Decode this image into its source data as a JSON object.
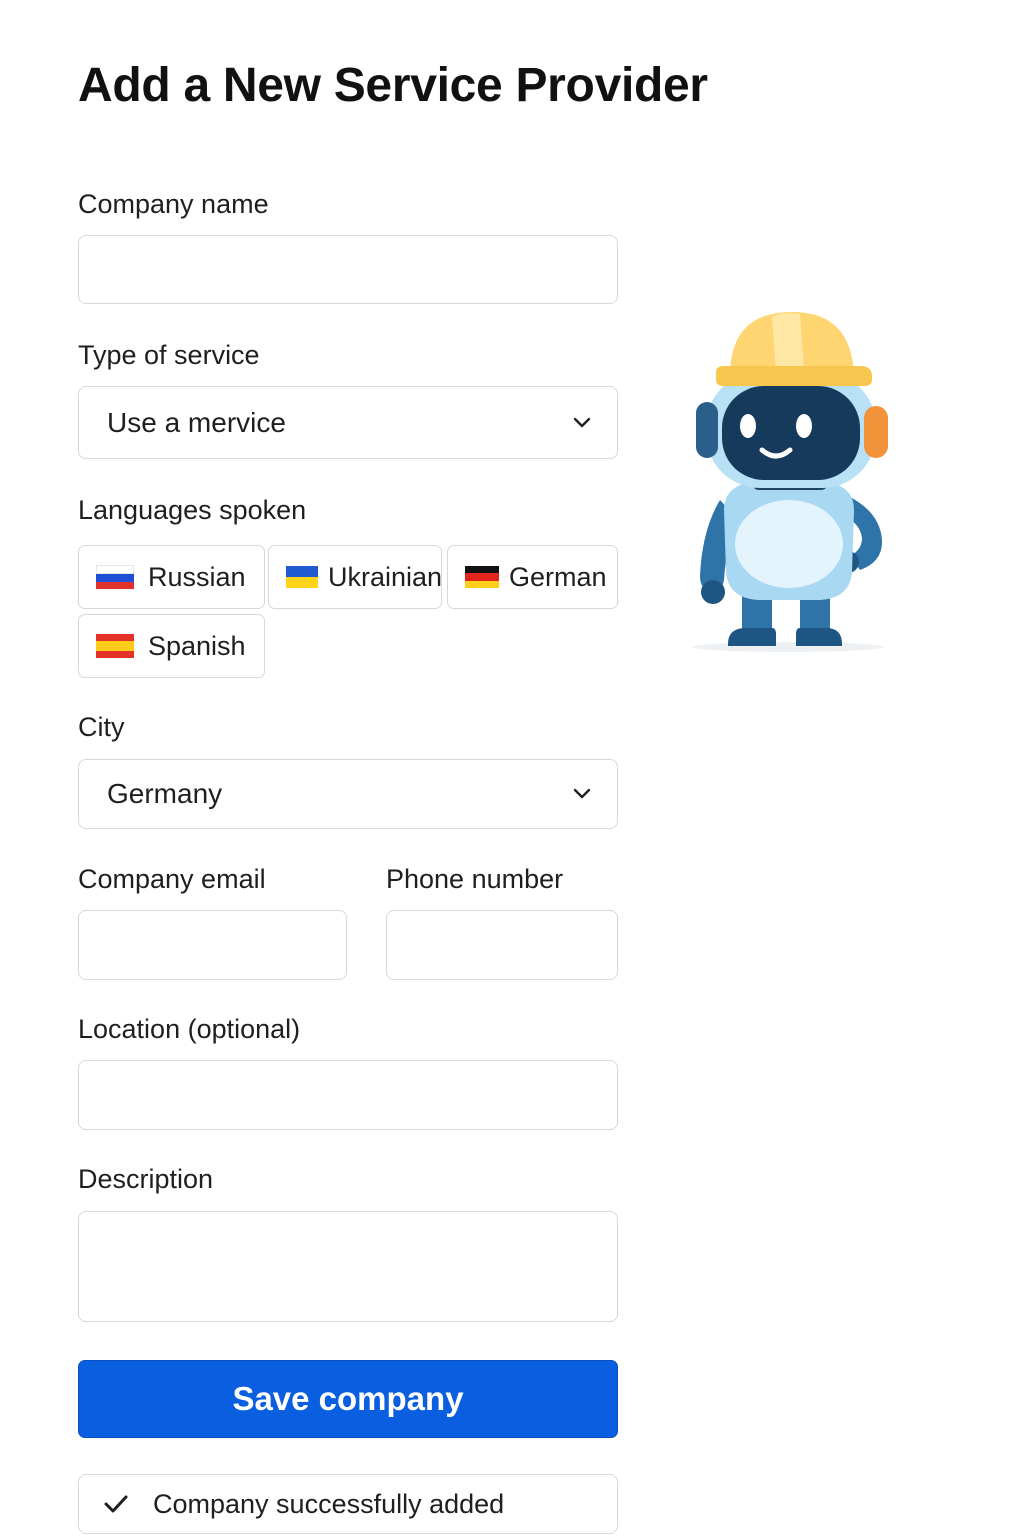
{
  "page": {
    "title": "Add a New Service Provider"
  },
  "form": {
    "company_name": {
      "label": "Company name",
      "value": "",
      "placeholder": ""
    },
    "service_type": {
      "label": "Type of service",
      "selected": "Use a mervice"
    },
    "languages": {
      "label": "Languages spoken",
      "options": [
        {
          "label": "Russian",
          "flag": "russia-flag",
          "colors": [
            "#ffffff",
            "#1e4fd6",
            "#e0312b"
          ]
        },
        {
          "label": "Ukrainian",
          "flag": "ukraine-flag",
          "colors": [
            "#1f5ad1",
            "#ffd31a"
          ]
        },
        {
          "label": "German",
          "flag": "germany-flag",
          "colors": [
            "#111111",
            "#e3241b",
            "#ffce1a"
          ]
        },
        {
          "label": "Spanish",
          "flag": "spain-flag",
          "colors": [
            "#e53228",
            "#ffcc1a",
            "#e53228"
          ]
        }
      ]
    },
    "city": {
      "label": "City",
      "selected": "Germany"
    },
    "company_email": {
      "label": "Company email",
      "value": "",
      "placeholder": ""
    },
    "phone_number": {
      "label": "Phone number",
      "value": "",
      "placeholder": ""
    },
    "location": {
      "label_main": "Location",
      "label_suffix": "(optional)",
      "value": "",
      "placeholder": ""
    },
    "description": {
      "label": "Description",
      "value": "",
      "placeholder": ""
    },
    "save_label": "Save company"
  },
  "toast": {
    "text": "Company successfully added",
    "icon": "checkmark-icon"
  },
  "mascot": {
    "icon": "robot-worker-mascot"
  },
  "colors": {
    "primary": "#0a5ee0",
    "border": "#d8d8d8",
    "text": "#1f1f1f"
  }
}
